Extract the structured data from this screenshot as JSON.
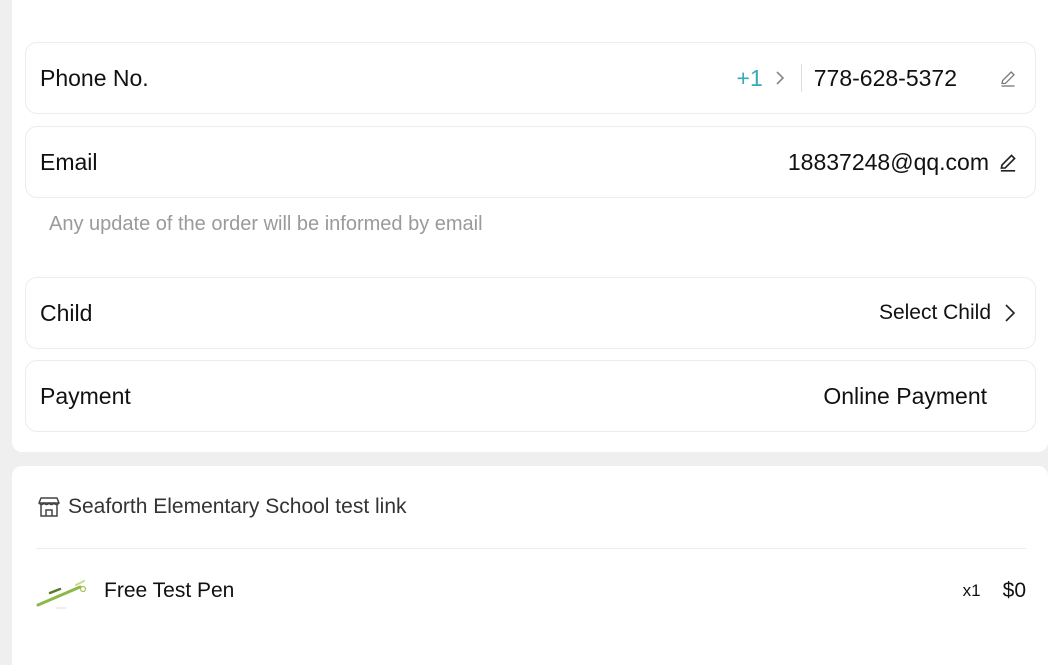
{
  "contact": {
    "phone_label": "Phone No.",
    "phone_code": "+1",
    "phone_number": "778-628-5372",
    "email_label": "Email",
    "email_value": "18837248@qq.com",
    "email_hint": "Any update of the order will be informed by email",
    "child_label": "Child",
    "child_value": "Select Child",
    "payment_label": "Payment",
    "payment_value": "Online Payment"
  },
  "order": {
    "store_name": "Seaforth Elementary School test link",
    "items": [
      {
        "name": "Free Test Pen",
        "qty": "x1",
        "price": "$0"
      }
    ]
  },
  "colors": {
    "accent": "#37a9b8",
    "hint": "#9a9a9a",
    "background": "#efefef"
  },
  "icons": [
    "chevron-right-icon",
    "edit-icon",
    "store-icon"
  ]
}
